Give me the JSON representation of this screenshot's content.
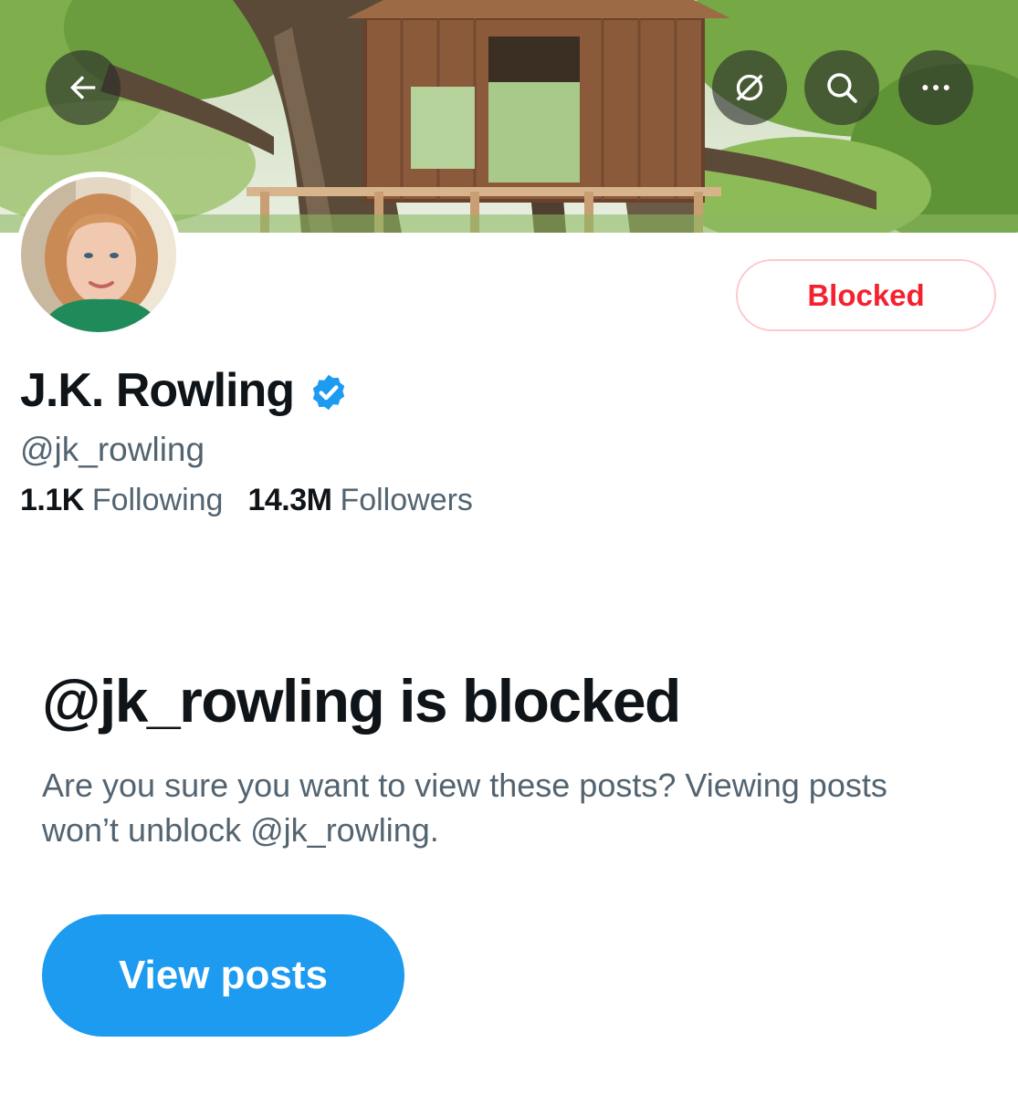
{
  "profile": {
    "display_name": "J.K. Rowling",
    "handle": "@jk_rowling",
    "following_count": "1.1K",
    "following_label": "Following",
    "followers_count": "14.3M",
    "followers_label": "Followers",
    "verified": true
  },
  "header": {
    "back_icon": "arrow-left-icon",
    "grok_icon": "grok-icon",
    "search_icon": "search-icon",
    "more_icon": "more-horizontal-icon"
  },
  "actions": {
    "blocked_label": "Blocked"
  },
  "notice": {
    "title": "@jk_rowling is blocked",
    "description": "Are you sure you want to view these posts? Viewing posts won’t unblock @jk_rowling.",
    "view_posts_label": "View posts"
  },
  "colors": {
    "accent": "#1d9bf0",
    "blocked_red": "#f4212e",
    "blocked_border": "#fdc9ce",
    "secondary_text": "#536471",
    "primary_text": "#0f1419"
  }
}
